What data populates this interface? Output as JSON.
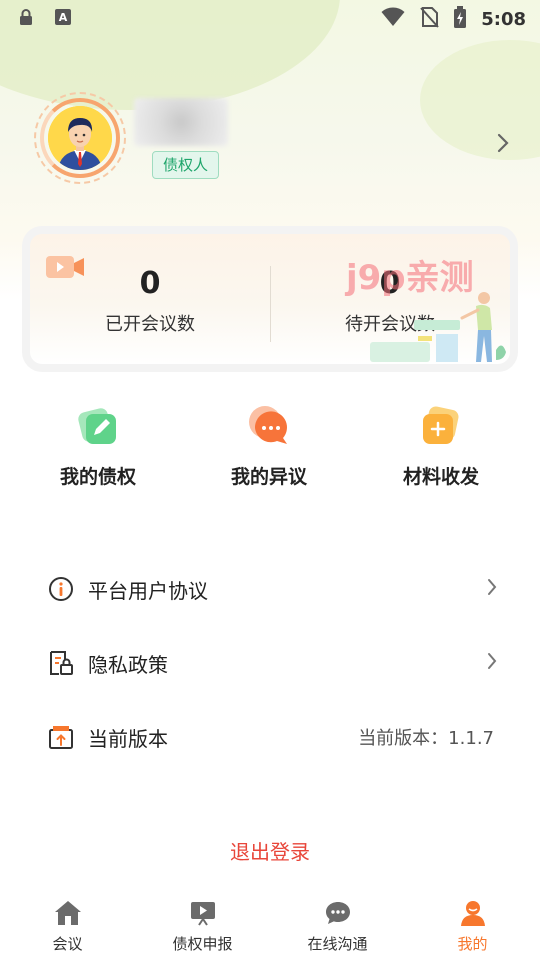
{
  "status_bar": {
    "time": "5:08",
    "icons": [
      "lock-icon",
      "a-keyboard-icon",
      "wifi-icon",
      "no-sim-icon",
      "battery-charging-icon"
    ]
  },
  "profile": {
    "role_badge": "债权人",
    "avatar_icon": "businessman-avatar-icon"
  },
  "stats": {
    "held_count": "0",
    "held_label": "已开会议数",
    "pending_count": "0",
    "pending_label": "待开会议数",
    "watermark": "j9p亲测"
  },
  "quick_actions": [
    {
      "label": "我的债权",
      "icon": "edit-card-icon",
      "color": "#5fd38a"
    },
    {
      "label": "我的异议",
      "icon": "chat-bubble-icon",
      "color": "#f7743a"
    },
    {
      "label": "材料收发",
      "icon": "add-folder-icon",
      "color": "#fbb13c"
    }
  ],
  "menu": {
    "agreement_label": "平台用户协议",
    "privacy_label": "隐私政策",
    "version_label": "当前版本",
    "version_value": "当前版本：1.1.7"
  },
  "logout_label": "退出登录",
  "tabbar": {
    "tabs": [
      {
        "label": "会议",
        "icon": "home-icon",
        "active": false
      },
      {
        "label": "债权申报",
        "icon": "presentation-board-icon",
        "active": false
      },
      {
        "label": "在线沟通",
        "icon": "chat-icon",
        "active": false
      },
      {
        "label": "我的",
        "icon": "user-icon",
        "active": true
      }
    ],
    "active_color": "#f7772d",
    "inactive_color": "#666666"
  }
}
